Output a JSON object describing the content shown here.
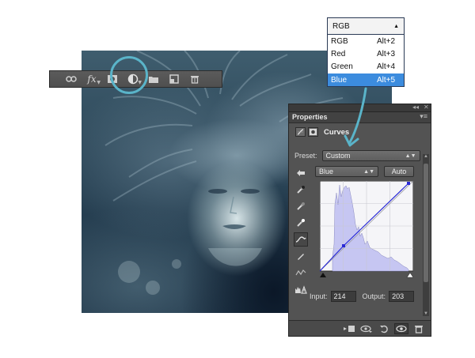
{
  "channel_menu": {
    "current": "RGB",
    "items": [
      {
        "label": "RGB",
        "shortcut": "Alt+2",
        "active": false
      },
      {
        "label": "Red",
        "shortcut": "Alt+3",
        "active": false
      },
      {
        "label": "Green",
        "shortcut": "Alt+4",
        "active": false
      },
      {
        "label": "Blue",
        "shortcut": "Alt+5",
        "active": true
      }
    ]
  },
  "properties": {
    "title": "Properties",
    "adjustment": "Curves",
    "preset_label": "Preset:",
    "preset_value": "Custom",
    "channel_value": "Blue",
    "auto_label": "Auto",
    "input_label": "Input:",
    "input_value": "214",
    "output_label": "Output:",
    "output_value": "203"
  },
  "icons": {
    "layers_toolbar": [
      "link-icon",
      "fx-icon",
      "mask-icon",
      "adjustment-layer-icon",
      "folder-icon",
      "new-layer-icon",
      "trash-icon"
    ],
    "tools": [
      "on-image-adjust-icon",
      "black-point-eyedropper-icon",
      "gray-point-eyedropper-icon",
      "white-point-eyedropper-icon",
      "curve-edit-icon",
      "pencil-draw-icon",
      "smooth-icon",
      "clipping-warning-icon"
    ],
    "bottom": [
      "clip-to-layer-icon",
      "view-previous-icon",
      "reset-icon",
      "visibility-icon",
      "delete-icon"
    ]
  },
  "colors": {
    "highlight": "#5ab4c9",
    "menu_selected": "#3c8cde",
    "curve": "#2a2ad6",
    "histogram": "#c6c6f2"
  }
}
